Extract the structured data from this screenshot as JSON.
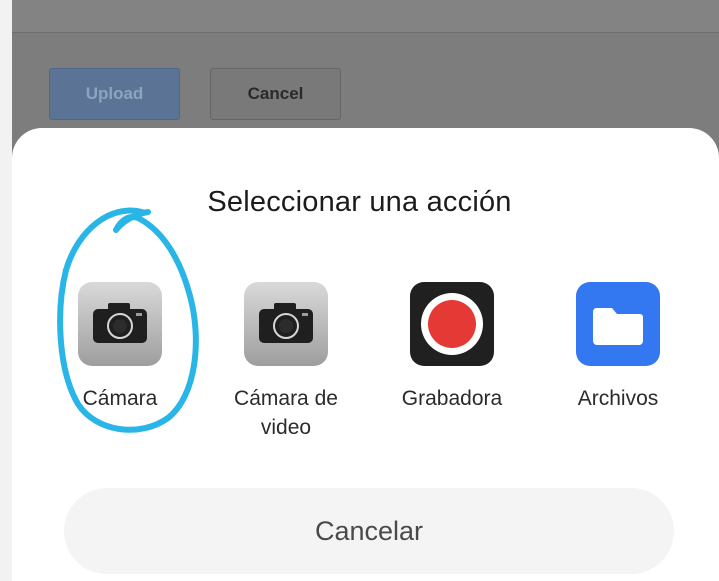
{
  "background_page": {
    "upload_label": "Upload",
    "cancel_label": "Cancel"
  },
  "action_sheet": {
    "title": "Seleccionar una acción",
    "actions": [
      {
        "label": "Cámara",
        "icon": "camera-icon"
      },
      {
        "label": "Cámara de\nvideo",
        "icon": "camera-icon"
      },
      {
        "label": "Grabadora",
        "icon": "record-icon"
      },
      {
        "label": "Archivos",
        "icon": "folder-icon"
      }
    ],
    "cancel_label": "Cancelar"
  },
  "colors": {
    "annotation": "#29b6e6",
    "files_blue": "#3478f1",
    "record_red": "#e53935"
  }
}
